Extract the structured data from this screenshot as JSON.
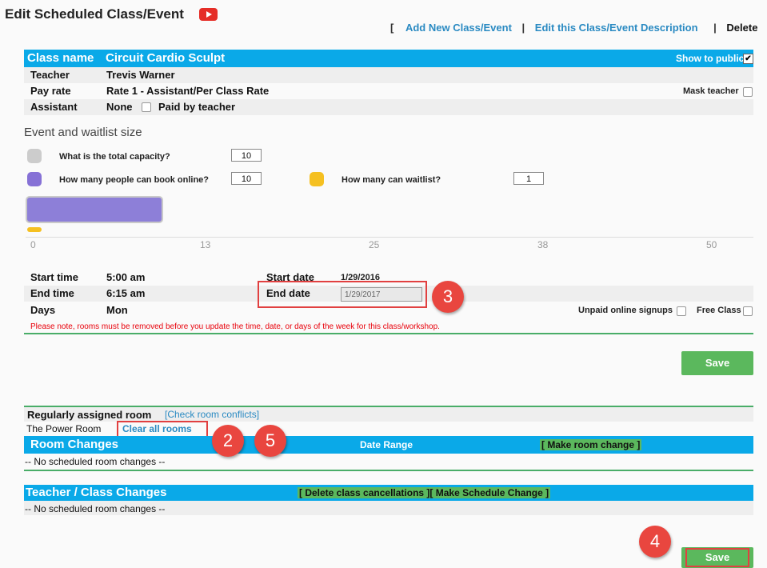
{
  "header": {
    "title": "Edit Scheduled Class/Event",
    "links": {
      "open": "[",
      "add": "Add New Class/Event",
      "sep": "|",
      "edit": "Edit this Class/Event Description",
      "delete": "Delete",
      "close": "]"
    }
  },
  "class_info": {
    "name_label": "Class name",
    "name_value": "Circuit Cardio Sculpt",
    "show_public_label": "Show to public",
    "show_public_checked": true,
    "teacher_label": "Teacher",
    "teacher_value": "Trevis Warner",
    "payrate_label": "Pay rate",
    "payrate_value": "Rate 1 - Assistant/Per Class Rate",
    "mask_teacher_label": "Mask teacher",
    "assistant_label": "Assistant",
    "assistant_value": "None",
    "paid_by_teacher_label": "Paid by teacher"
  },
  "size": {
    "heading": "Event and waitlist size",
    "capacity_q": "What is the total capacity?",
    "capacity_val": "10",
    "online_q": "How many people can book online?",
    "online_val": "10",
    "waitlist_q": "How many can waitlist?",
    "waitlist_val": "1",
    "colors": {
      "capacity": "#cccccc",
      "online": "#8671d6",
      "waitlist": "#f5c021"
    },
    "ticks": [
      "0",
      "13",
      "25",
      "38",
      "50"
    ],
    "online_fraction": 0.2
  },
  "schedule": {
    "start_time_label": "Start time",
    "start_time": "5:00 am",
    "start_date_label": "Start date",
    "start_date": "1/29/2016",
    "end_time_label": "End time",
    "end_time": "6:15 am",
    "end_date_label": "End date",
    "end_date": "1/29/2017",
    "days_label": "Days",
    "days": "Mon",
    "unpaid_label": "Unpaid online signups",
    "free_label": "Free Class",
    "note": "Please note, rooms must be removed before you update the time, date, or days of the week for this class/workshop."
  },
  "save_label": "Save",
  "rooms": {
    "assigned_label": "Regularly assigned room",
    "check_conflicts": "[Check room conflicts]",
    "room_name": "The Power Room",
    "clear_all": "Clear all rooms",
    "changes_title": "Room Changes",
    "date_range": "Date Range",
    "make_change": "[ Make room change ]",
    "none": "-- No scheduled room changes --"
  },
  "teacher_changes": {
    "title": "Teacher / Class Changes",
    "actions": "[ Delete class cancellations ][ Make Schedule Change ]",
    "none": "-- No scheduled room changes --"
  },
  "callouts": {
    "c2": "2",
    "c3": "3",
    "c4": "4",
    "c5": "5"
  }
}
